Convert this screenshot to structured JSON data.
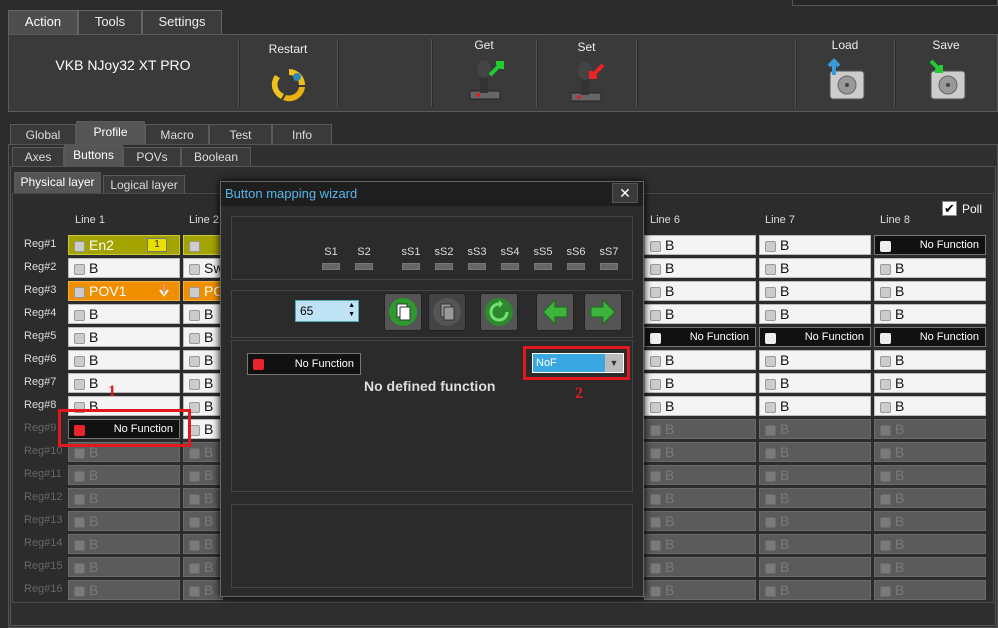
{
  "menu_tabs": [
    "Action",
    "Tools",
    "Settings"
  ],
  "device_name": "VKB NJoy32 XT PRO",
  "toolbar": {
    "restart": "Restart",
    "get": "Get",
    "set": "Set",
    "load": "Load",
    "save": "Save"
  },
  "main_tabs": [
    "Global",
    "Profile",
    "Macro",
    "Test",
    "Info"
  ],
  "sub_tabs": [
    "Axes",
    "Buttons",
    "POVs",
    "Boolean"
  ],
  "layer_tabs": [
    "Physical layer",
    "Logical layer"
  ],
  "poll_label": "Poll",
  "line_headers": [
    "Line 1",
    "Line 2",
    "Line 6",
    "Line 7",
    "Line 8"
  ],
  "regs": [
    "Reg#1",
    "Reg#2",
    "Reg#3",
    "Reg#4",
    "Reg#5",
    "Reg#6",
    "Reg#7",
    "Reg#8",
    "Reg#9",
    "Reg#10",
    "Reg#11",
    "Reg#12",
    "Reg#13",
    "Reg#14",
    "Reg#15",
    "Reg#16"
  ],
  "cells": {
    "en2": "En2",
    "en2_badge": "1",
    "b": "B",
    "sw": "Sw",
    "pov1": "POV1",
    "po": "PO",
    "no_function": "No Function"
  },
  "wizard": {
    "title": "Button mapping wizard",
    "close": "✕",
    "s_labels": [
      "S1",
      "S2",
      "sS1",
      "sS2",
      "sS3",
      "sS4",
      "sS5",
      "sS6",
      "sS7"
    ],
    "spin_value": "65",
    "no_function": "No Function",
    "dropdown_value": "NoF",
    "message": "No defined function"
  },
  "annotations": {
    "one": "1",
    "two": "2"
  },
  "colors": {
    "olive": "#a4a400",
    "orange": "#f09000",
    "accent_blue": "#58b4e8",
    "annotation_red": "#e01820"
  }
}
